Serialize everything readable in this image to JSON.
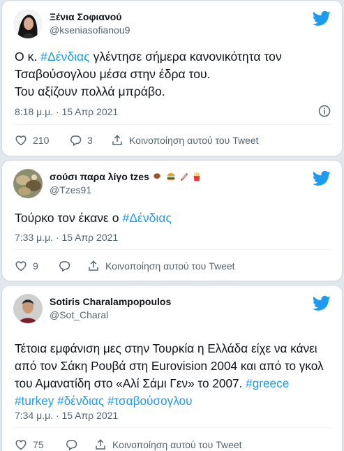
{
  "tweets": [
    {
      "display_name": "Ξένια Σοφιανού",
      "handle": "@kseniasofianou9",
      "text_parts": [
        {
          "t": "Ο κ. "
        },
        {
          "t": "#Δένδιας",
          "tag": true
        },
        {
          "t": " γλέντησε σήμερα  κανονικότητα τον Τσαβούσογλου μέσα στην έδρα του.\nΤου αξίζουν πολλά μπράβο."
        }
      ],
      "timestamp": "8:18 μ.μ. · 15 Απρ 2021",
      "likes": "210",
      "replies": "3",
      "share_label": "Κοινοποίηση αυτού του Tweet"
    },
    {
      "display_name": "σούσι παρα λίγο tzes",
      "name_emojis": [
        "poultry-leg-emoji",
        "hamburger-emoji",
        "bacon-emoji",
        "fries-emoji"
      ],
      "handle": "@Tzes91",
      "text_parts": [
        {
          "t": "Τούρκο τον έκανε ο "
        },
        {
          "t": "#Δένδιας",
          "tag": true
        }
      ],
      "timestamp": "7:33 μ.μ. · 15 Απρ 2021",
      "likes": "9",
      "replies": "",
      "share_label": "Κοινοποίηση αυτού του Tweet"
    },
    {
      "display_name": "Sotiris Charalampopoulos",
      "handle": "@Sot_Charal",
      "text_parts": [
        {
          "t": "Τέτοια εμφάνιση μες στην Τουρκία η Ελλάδα είχε να κάνει από τον Σάκη Ρουβά στη Eurovision 2004 και από το γκολ του Αμανατίδη στο «Αλί Σάμι Γεν» το 2007. "
        },
        {
          "t": "#greece",
          "tag": true
        },
        {
          "t": " "
        },
        {
          "t": "#turkey",
          "tag": true
        },
        {
          "t": " "
        },
        {
          "t": "#δένδιας",
          "tag": true
        },
        {
          "t": " "
        },
        {
          "t": "#τσαβούσογλου",
          "tag": true
        }
      ],
      "timestamp": "7:34 μ.μ. · 15 Απρ 2021",
      "likes": "75",
      "replies": "",
      "share_label": "Κοινοποίηση αυτού του Tweet"
    }
  ],
  "colors": {
    "accent": "#1d9bf0",
    "text": "#0f1419",
    "muted": "#536471",
    "background": "#e1e8ed"
  },
  "icons": [
    "twitter-bird-icon",
    "info-icon",
    "heart-icon",
    "reply-icon",
    "share-icon"
  ]
}
